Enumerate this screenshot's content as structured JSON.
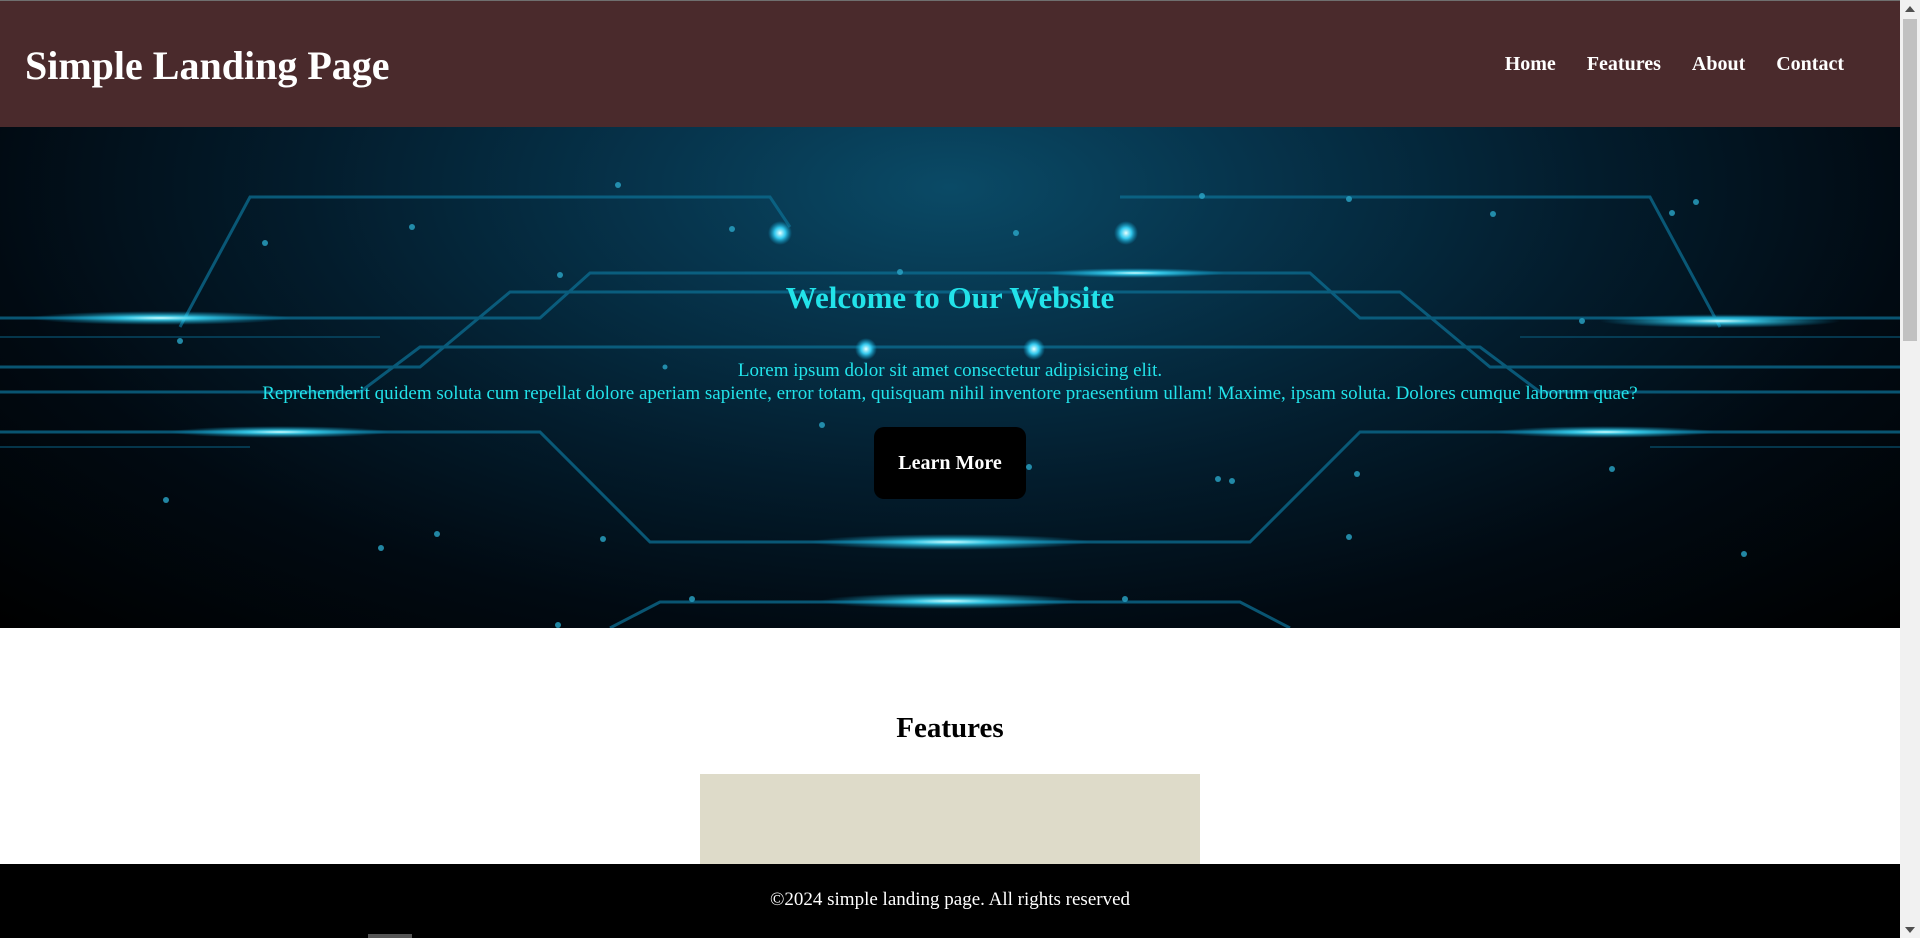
{
  "header": {
    "brand": "Simple Landing Page",
    "nav": [
      "Home",
      "Features",
      "About",
      "Contact"
    ]
  },
  "hero": {
    "title": "Welcome to Our Website",
    "line1": "Lorem ipsum dolor sit amet consectetur adipisicing elit.",
    "line2": "Reprehenderit quidem soluta cum repellat dolore aperiam sapiente, error totam, quisquam nihil inventore praesentium ullam! Maxime, ipsam soluta. Dolores cumque laborum quae?",
    "cta": "Learn More"
  },
  "features": {
    "title": "Features"
  },
  "footer": {
    "text": "©2024 simple landing page. All rights reserved"
  },
  "colors": {
    "header_bg": "#4a2a2c",
    "hero_text": "#22e3ea",
    "feature_card": "#dedbc9",
    "footer_bg": "#000000"
  },
  "icons": [
    "scroll-up-arrow-icon",
    "scroll-down-arrow-icon"
  ]
}
